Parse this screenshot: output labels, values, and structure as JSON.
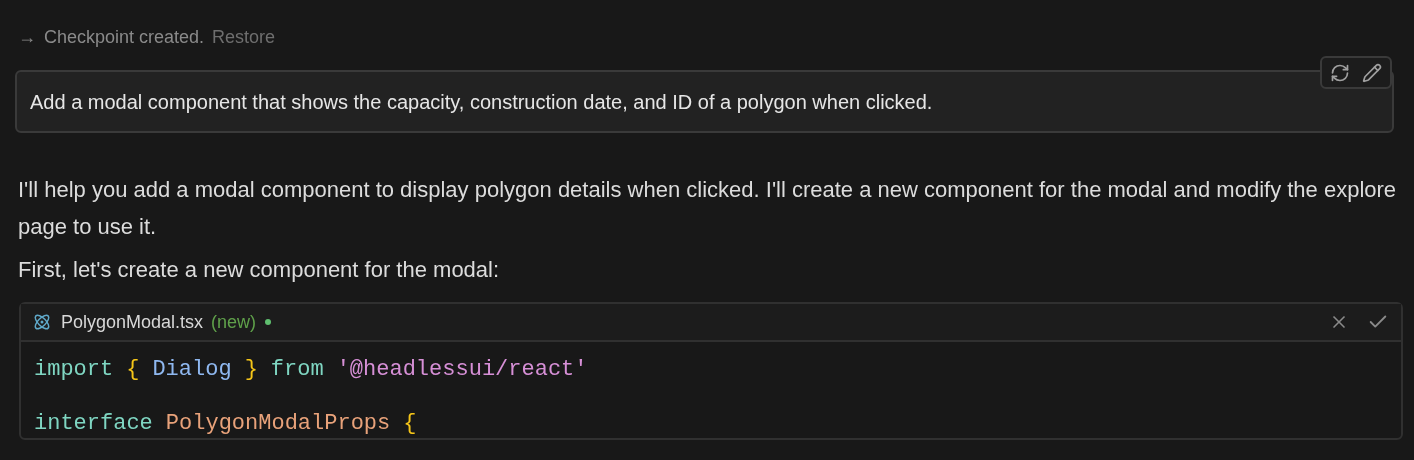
{
  "checkpoint": {
    "arrow": "→",
    "text": "Checkpoint created.",
    "restore": "Restore"
  },
  "prompt": {
    "text": "Add a modal component that shows the capacity, construction date, and ID of a polygon when clicked."
  },
  "response": [
    "I'll help you add a modal component to display polygon details when clicked. I'll create a new component for the modal and modify the explore page to use it.",
    "First, let's create a new component for the modal:"
  ],
  "code_block": {
    "filename": "PolygonModal.tsx",
    "status": "(new)",
    "lines": [
      [
        {
          "kind": "keyword",
          "text": "import"
        },
        {
          "kind": "punct",
          "text": "{"
        },
        {
          "kind": "ident",
          "text": "Dialog"
        },
        {
          "kind": "punct",
          "text": "}"
        },
        {
          "kind": "keyword",
          "text": "from"
        },
        {
          "kind": "string",
          "text": "'@headlessui/react'"
        }
      ],
      [
        {
          "kind": "blank_line"
        },
        {
          "kind": "keyword",
          "text": "interface"
        },
        {
          "kind": "type",
          "text": "PolygonModalProps"
        },
        {
          "kind": "punct",
          "text": "{"
        }
      ]
    ]
  }
}
